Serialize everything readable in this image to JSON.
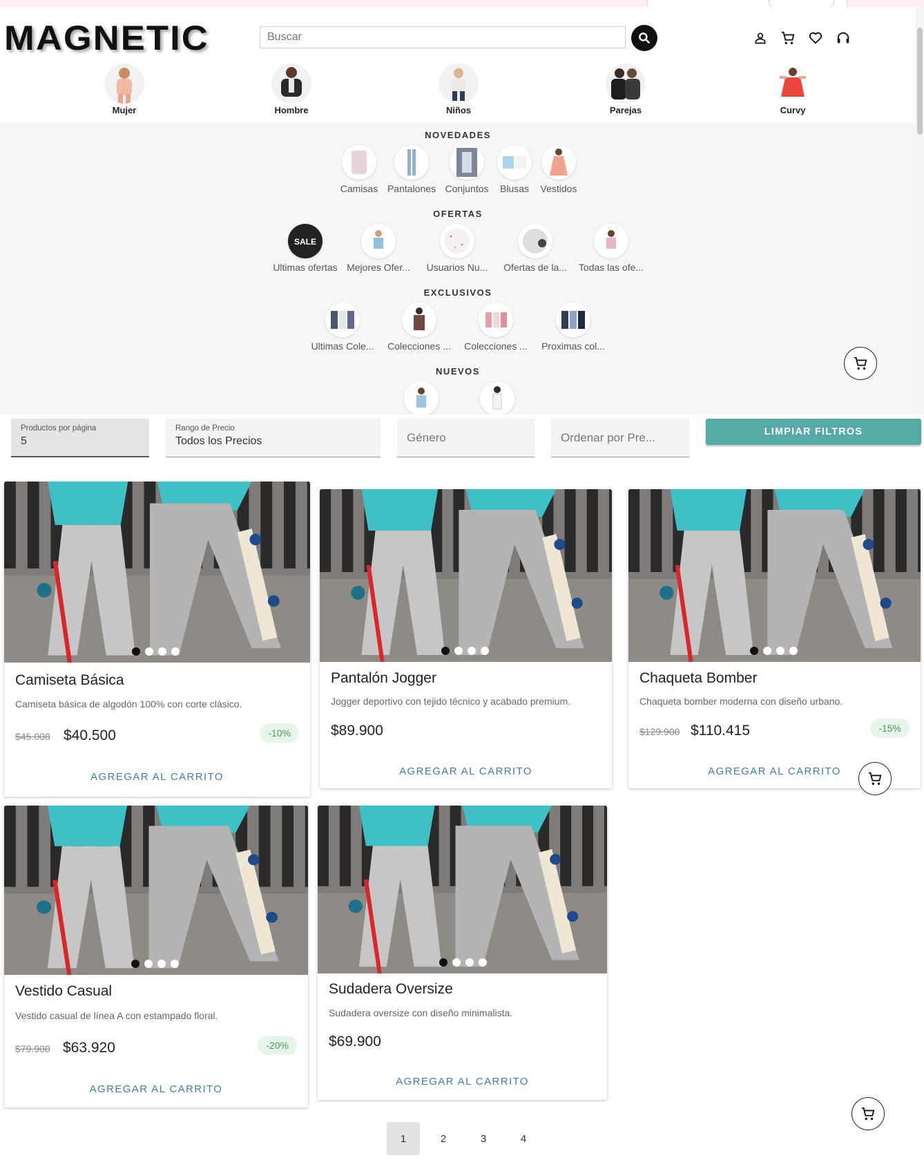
{
  "brand": {
    "logo_text": "MAGNETIC"
  },
  "search": {
    "placeholder": "Buscar"
  },
  "header_icons": [
    "user-icon",
    "cart-icon",
    "heart-icon",
    "headset-icon"
  ],
  "categories": [
    {
      "label": "Mujer"
    },
    {
      "label": "Hombre"
    },
    {
      "label": "Niños"
    },
    {
      "label": "Parejas"
    },
    {
      "label": "Curvy"
    }
  ],
  "menu": {
    "novedades": {
      "title": "NOVEDADES",
      "items": [
        "Camisas",
        "Pantalones",
        "Conjuntos",
        "Blusas",
        "Vestidos"
      ]
    },
    "ofertas": {
      "title": "OFERTAS",
      "items": [
        "Ultimas ofertas",
        "Mejores Ofer...",
        "Usuarios Nu...",
        "Ofertas de la...",
        "Todas las ofe..."
      ]
    },
    "exclusivos": {
      "title": "EXCLUSIVOS",
      "items": [
        "Ultimas Cole...",
        "Colecciones ...",
        "Colecciones ...",
        "Proximas col..."
      ]
    },
    "nuevos": {
      "title": "NUEVOS"
    }
  },
  "filters": {
    "per_page": {
      "label": "Productos por página",
      "value": "5"
    },
    "price_range": {
      "label": "Rango de Precio",
      "value": "Todos los Precios"
    },
    "gender": {
      "placeholder": "Género"
    },
    "sort": {
      "placeholder": "Ordenar por Pre..."
    },
    "clear_label": "LIMPIAR FILTROS"
  },
  "products": [
    {
      "title": "Camiseta Básica",
      "desc": "Camiseta básica de algodón 100% con corte clásico.",
      "old_price": "$45.000",
      "price": "$40.500",
      "discount": "-10%",
      "cta": "AGREGAR AL CARRITO"
    },
    {
      "title": "Pantalón Jogger",
      "desc": "Jogger deportivo con tejido técnico y acabado premium.",
      "old_price": "",
      "price": "$89.900",
      "discount": "",
      "cta": "AGREGAR AL CARRITO"
    },
    {
      "title": "Chaqueta Bomber",
      "desc": "Chaqueta bomber moderna con diseño urbano.",
      "old_price": "$129.900",
      "price": "$110.415",
      "discount": "-15%",
      "cta": "AGREGAR AL CARRITO"
    },
    {
      "title": "Vestido Casual",
      "desc": "Vestido casual de línea A con estampado floral.",
      "old_price": "$79.900",
      "price": "$63.920",
      "discount": "-20%",
      "cta": "AGREGAR AL CARRITO"
    },
    {
      "title": "Sudadera Oversize",
      "desc": "Sudadera oversize con diseño minimalista.",
      "old_price": "",
      "price": "$69.900",
      "discount": "",
      "cta": "AGREGAR AL CARRITO"
    }
  ],
  "pagination": {
    "pages": [
      "1",
      "2",
      "3",
      "4"
    ],
    "current": "1"
  },
  "colors": {
    "accent": "#55aaa6",
    "link": "#3a7fa6",
    "discount_bg": "#e7f4ea",
    "discount_text": "#4d9a5a"
  }
}
